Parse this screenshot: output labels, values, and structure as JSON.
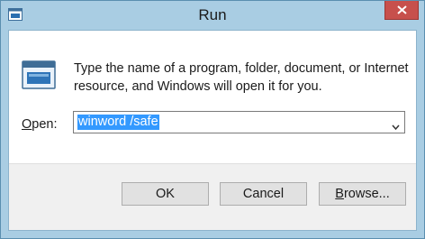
{
  "window": {
    "title": "Run",
    "close_icon": "close-icon",
    "title_icon": "run-app-icon"
  },
  "content": {
    "description": "Type the name of a program, folder, document, or Internet resource, and Windows will open it for you.",
    "open_label_prefix": "O",
    "open_label_suffix": "pen:",
    "open_value": "winword /safe",
    "open_icon": "run-app-icon"
  },
  "buttons": {
    "ok": "OK",
    "cancel": "Cancel",
    "browse_prefix": "B",
    "browse_suffix": "rowse..."
  },
  "colors": {
    "titlebar": "#a9cde3",
    "close": "#c7504c",
    "selection": "#3399ff"
  }
}
